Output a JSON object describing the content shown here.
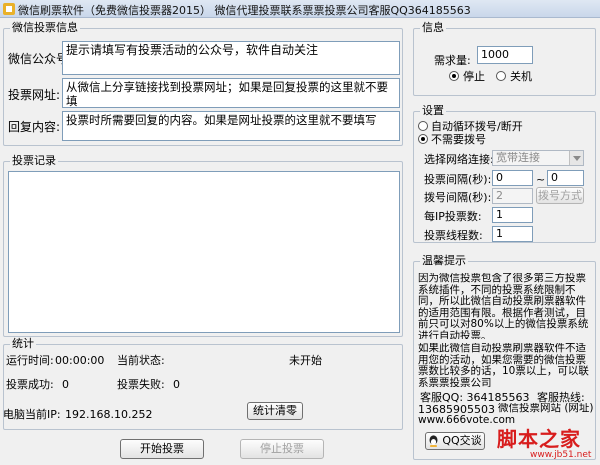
{
  "window": {
    "title": "微信刷票软件（免费微信投票器2015）     微信代理投票联系票票投票公司客服QQ364185563"
  },
  "info_panel": {
    "legend": "微信投票信息",
    "account_label": "微信公众号",
    "account_value": "提示请填写有投票活动的公众号，软件自动关注",
    "url_label": "投票网址:",
    "url_value": "从微信上分享链接找到投票网址；如果是回复投票的这里就不要填",
    "reply_label": "回复内容:",
    "reply_value": "投票时所需要回复的内容。如果是网址投票的这里就不要填写"
  },
  "info_box": {
    "legend": "信息",
    "demand_label": "需求量:",
    "demand_value": "1000",
    "stop_label": "停止",
    "shutdown_label": "关机"
  },
  "settings": {
    "legend": "设置",
    "auto_dial_label": "自动循环拨号/断开",
    "no_dial_label": "不需要拨号",
    "network_label": "选择网络连接:",
    "network_value": "宽带连接",
    "interval_label": "投票间隔(秒):",
    "interval_from": "0",
    "interval_sep": "~",
    "interval_to": "0",
    "dial_interval_label": "拨号间隔(秒):",
    "dial_interval_value": "2",
    "dial_mode_button": "拨号方式",
    "per_ip_label": "每IP投票数:",
    "per_ip_value": "1",
    "threads_label": "投票线程数:",
    "threads_value": "1"
  },
  "tips": {
    "legend": "温馨提示",
    "para1": "因为微信投票包含了很多第三方投票系统插件，不同的投票系统限制不同，所以此微信自动投票刷票器软件的适用范围有限。根据作者测试，目前只可以对80%以上的微信投票系统进行自动投票。",
    "para2": "如果此微信自动投票刷票器软件不适用您的活动，如果您需要的微信投票票数比较多的话，10票以上，可以联系票票投票公司",
    "service_qq": "客服QQ: 364185563",
    "hotline": "客服热线:",
    "phone": "13685905503",
    "website_line": "微信投票网站 (网址) www.666vote.com",
    "qq_button": "QQ交谈"
  },
  "log": {
    "legend": "投票记录"
  },
  "stats": {
    "legend": "统计",
    "runtime_label": "运行时间:",
    "runtime_value": "00:00:00",
    "status_label": "当前状态:",
    "status_value": "未开始",
    "success_label": "投票成功:",
    "success_value": "0",
    "fail_label": "投票失败:",
    "fail_value": "0",
    "ip_label": "电脑当前IP:",
    "ip_value": "192.168.10.252",
    "clear_button": "统计清零"
  },
  "actions": {
    "start_button": "开始投票",
    "stop_button": "停止投票"
  },
  "watermark": {
    "brand": "脚本之家",
    "url": "www.jb51.net"
  }
}
